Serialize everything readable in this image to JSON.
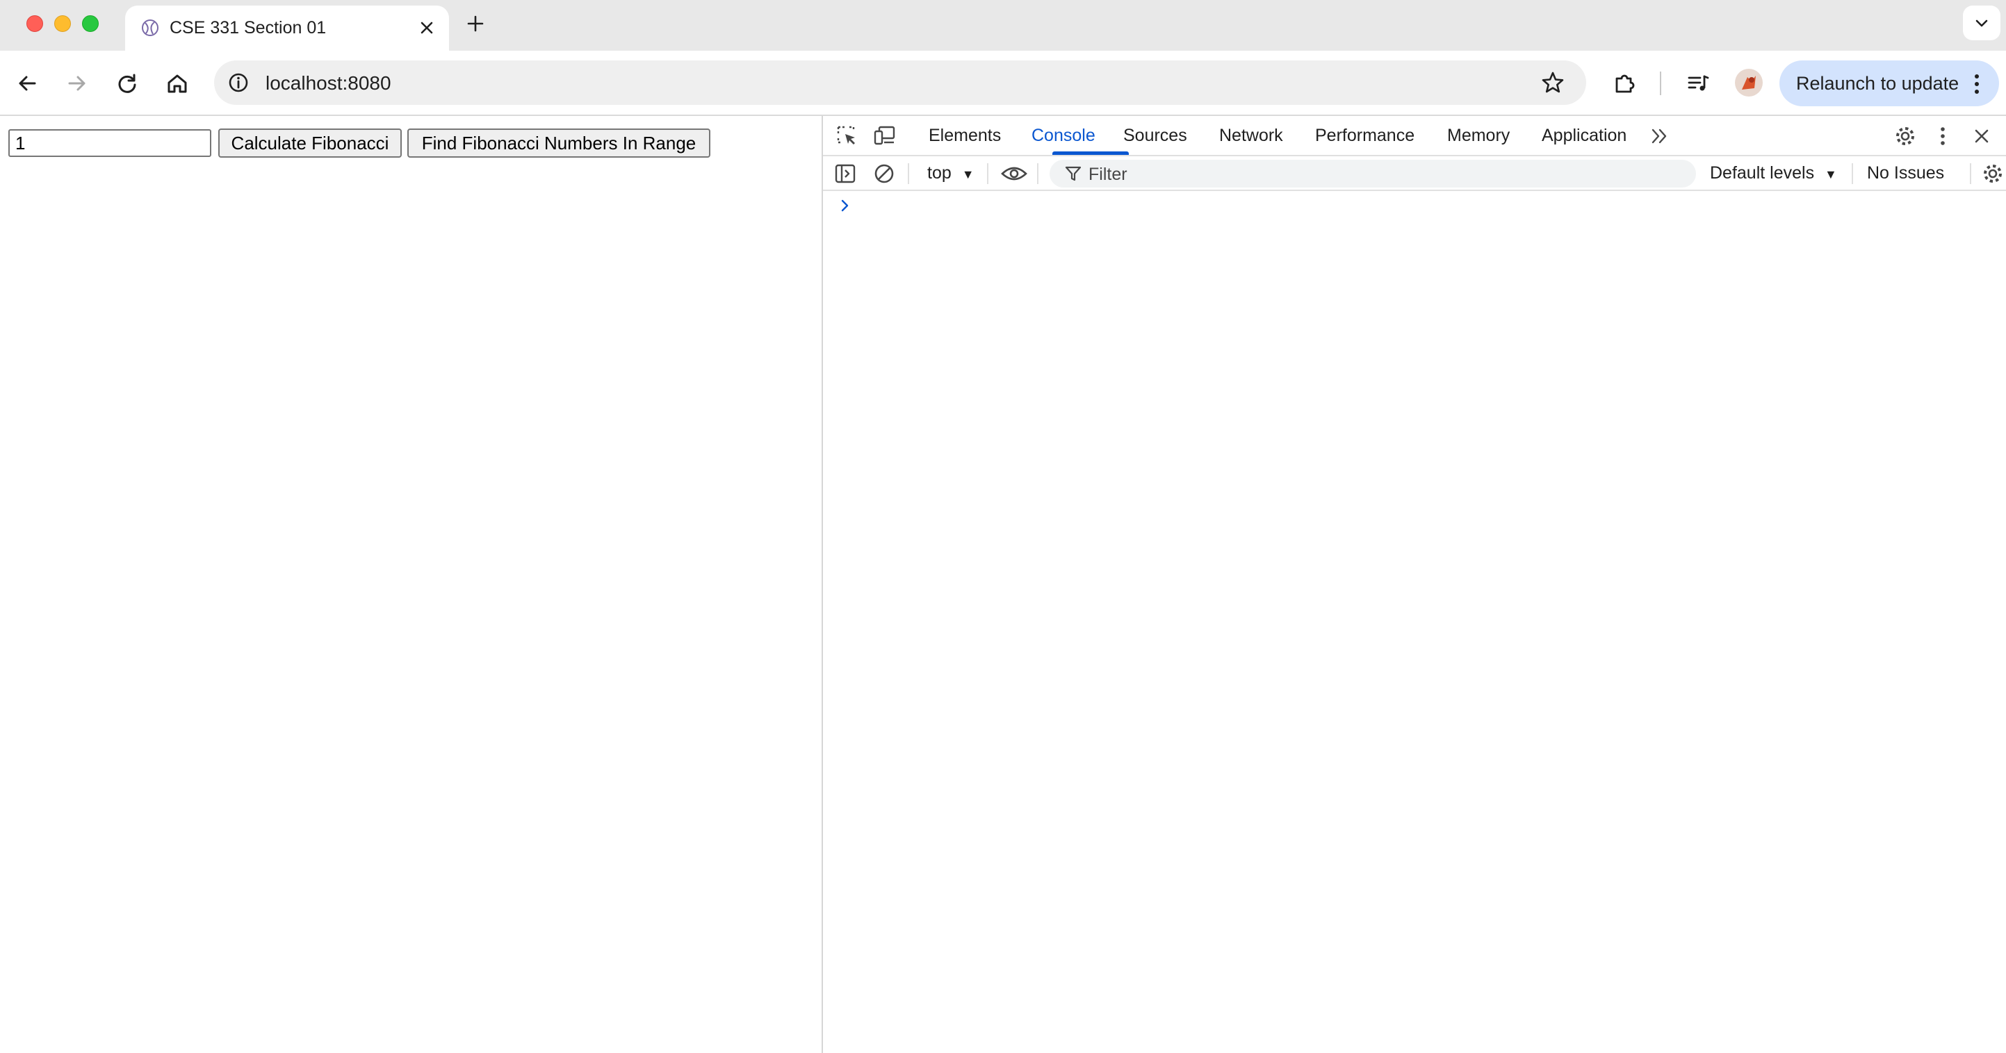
{
  "browser": {
    "tab": {
      "title": "CSE 331 Section 01"
    },
    "address_bar": {
      "url": "localhost:8080"
    },
    "relaunch_label": "Relaunch to update"
  },
  "page": {
    "input_value": "1",
    "calculate_label": "Calculate Fibonacci",
    "range_label": "Find Fibonacci Numbers In Range"
  },
  "devtools": {
    "tabs": [
      "Elements",
      "Console",
      "Sources",
      "Network",
      "Performance",
      "Memory",
      "Application"
    ],
    "active_tab": "Console",
    "context": "top",
    "filter_placeholder": "Filter",
    "levels_label": "Default levels",
    "issues_label": "No Issues"
  },
  "colors": {
    "accent": "#0b57d0",
    "relaunch_bg": "#d3e3fd",
    "tabstrip_bg": "#e8e8e8"
  },
  "icons": {
    "browser": [
      "back-icon",
      "forward-icon",
      "reload-icon",
      "home-icon",
      "site-info-icon",
      "bookmark-star-icon",
      "extensions-icon",
      "media-controls-icon",
      "avatar",
      "more-vert-icon"
    ],
    "devtools": [
      "inspect-element-icon",
      "device-toggle-icon",
      "more-tabs-icon",
      "settings-icon",
      "more-vert-icon",
      "close-icon",
      "sidebar-toggle-icon",
      "clear-console-icon",
      "eye-icon",
      "filter-icon",
      "console-settings-icon"
    ]
  }
}
